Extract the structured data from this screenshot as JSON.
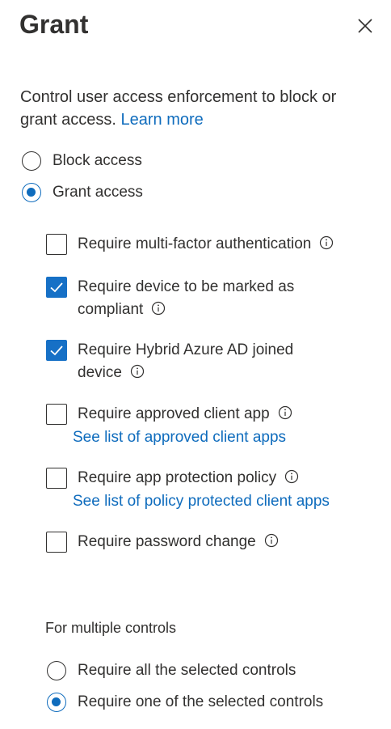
{
  "panel": {
    "title": "Grant",
    "description": "Control user access enforcement to block or grant access.",
    "learn_more": "Learn more"
  },
  "access": {
    "options": [
      {
        "label": "Block access",
        "selected": false
      },
      {
        "label": "Grant access",
        "selected": true
      }
    ]
  },
  "controls": [
    {
      "label": "Require multi-factor authentication",
      "checked": false,
      "link": ""
    },
    {
      "label": "Require device to be marked as compliant",
      "checked": true,
      "link": ""
    },
    {
      "label": "Require Hybrid Azure AD joined device",
      "checked": true,
      "link": ""
    },
    {
      "label": "Require approved client app",
      "checked": false,
      "link": "See list of approved client apps"
    },
    {
      "label": "Require app protection policy",
      "checked": false,
      "link": "See list of policy protected client apps"
    },
    {
      "label": "Require password change",
      "checked": false,
      "link": ""
    }
  ],
  "multiple": {
    "title": "For multiple controls",
    "options": [
      {
        "label": "Require all the selected controls",
        "selected": false
      },
      {
        "label": "Require one of the selected controls",
        "selected": true
      }
    ]
  },
  "colors": {
    "accent": "#0f6cbd",
    "checkbox_fill": "#1670c6",
    "text": "#323130"
  },
  "icons": {
    "close": "close-icon",
    "info": "info-icon",
    "check": "checkmark-icon"
  }
}
